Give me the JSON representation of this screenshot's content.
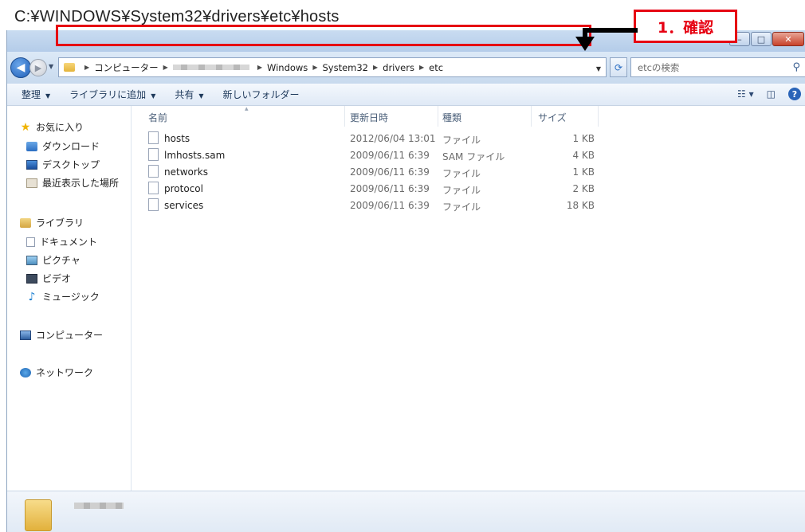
{
  "caption": "C:¥WINDOWS¥System32¥drivers¥etc¥hosts",
  "annotation": {
    "label": "1．確認",
    "color": "#e60012"
  },
  "window": {
    "minimize": "–",
    "maximize": "□",
    "close": "✕"
  },
  "nav": {
    "back_icon": "back-arrow-icon",
    "forward_icon": "forward-arrow-icon"
  },
  "address_bar": {
    "segments": [
      "コンピューター",
      "Windows",
      "System32",
      "drivers",
      "etc"
    ]
  },
  "search": {
    "placeholder": "etcの検索"
  },
  "toolbar": {
    "organize": "整理",
    "add_to_library": "ライブラリに追加",
    "share": "共有",
    "new_folder": "新しいフォルダー"
  },
  "sidebar": {
    "favorites": "お気に入り",
    "downloads": "ダウンロード",
    "desktop": "デスクトップ",
    "recent": "最近表示した場所",
    "libraries": "ライブラリ",
    "documents": "ドキュメント",
    "pictures": "ピクチャ",
    "videos": "ビデオ",
    "music": "ミュージック",
    "computer": "コンピューター",
    "network": "ネットワーク"
  },
  "columns": {
    "name": "名前",
    "date": "更新日時",
    "type": "種類",
    "size": "サイズ"
  },
  "files": [
    {
      "name": "hosts",
      "date": "2012/06/04 13:01",
      "type": "ファイル",
      "size": "1 KB"
    },
    {
      "name": "lmhosts.sam",
      "date": "2009/06/11 6:39",
      "type": "SAM ファイル",
      "size": "4 KB"
    },
    {
      "name": "networks",
      "date": "2009/06/11 6:39",
      "type": "ファイル",
      "size": "1 KB"
    },
    {
      "name": "protocol",
      "date": "2009/06/11 6:39",
      "type": "ファイル",
      "size": "2 KB"
    },
    {
      "name": "services",
      "date": "2009/06/11 6:39",
      "type": "ファイル",
      "size": "18 KB"
    }
  ]
}
